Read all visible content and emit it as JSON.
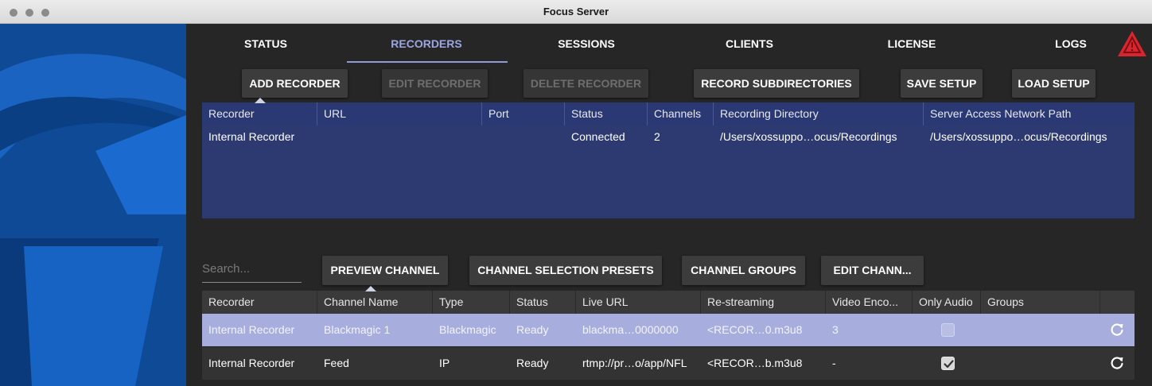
{
  "window": {
    "title": "Focus Server"
  },
  "tabs": [
    {
      "label": "STATUS"
    },
    {
      "label": "RECORDERS",
      "active": true
    },
    {
      "label": "SESSIONS"
    },
    {
      "label": "CLIENTS"
    },
    {
      "label": "LICENSE"
    },
    {
      "label": "LOGS"
    }
  ],
  "toolbar": {
    "add_recorder": "ADD RECORDER",
    "edit_recorder": "EDIT RECORDER",
    "delete_recorder": "DELETE RECORDER",
    "record_subdirectories": "RECORD SUBDIRECTORIES",
    "save_setup": "SAVE SETUP",
    "load_setup": "LOAD SETUP"
  },
  "recorders_table": {
    "columns": [
      "Recorder",
      "URL",
      "Port",
      "Status",
      "Channels",
      "Recording Directory",
      "Server Access Network Path"
    ],
    "rows": [
      {
        "recorder": "Internal Recorder",
        "url": "",
        "port": "",
        "status": "Connected",
        "channels": "2",
        "recording_directory": "/Users/xossuppo…ocus/Recordings",
        "network_path": "/Users/xossuppo…ocus/Recordings"
      }
    ]
  },
  "search": {
    "placeholder": "Search..."
  },
  "channel_toolbar": {
    "preview_channel": "PREVIEW CHANNEL",
    "channel_selection_presets": "CHANNEL SELECTION PRESETS",
    "channel_groups": "CHANNEL GROUPS",
    "edit_channel": "EDIT CHANN..."
  },
  "channels_table": {
    "columns": [
      "Recorder",
      "Channel Name",
      "Type",
      "Status",
      "Live URL",
      "Re-streaming",
      "Video Enco...",
      "Only Audio",
      "Groups",
      ""
    ],
    "rows": [
      {
        "recorder": "Internal Recorder",
        "channel_name": "Blackmagic 1",
        "type": "Blackmagic",
        "status": "Ready",
        "live_url": "blackma…0000000",
        "restreaming": "<RECOR…0.m3u8",
        "video_encoder": "3",
        "only_audio": false,
        "groups": "",
        "selected": true
      },
      {
        "recorder": "Internal Recorder",
        "channel_name": "Feed",
        "type": "IP",
        "status": "Ready",
        "live_url": "rtmp://pr…o/app/NFL",
        "restreaming": "<RECOR…b.m3u8",
        "video_encoder": "-",
        "only_audio": true,
        "groups": "",
        "selected": false
      }
    ]
  },
  "colors": {
    "accent": "#9aa7e0",
    "table_blue": "#2d3a72",
    "selected_row": "#a7aedd",
    "sidebar": "#0f4e9c",
    "warning": "#d9262e"
  },
  "icons": [
    "warning-icon",
    "refresh-icon",
    "sort-caret-icon",
    "checkbox-icon"
  ]
}
